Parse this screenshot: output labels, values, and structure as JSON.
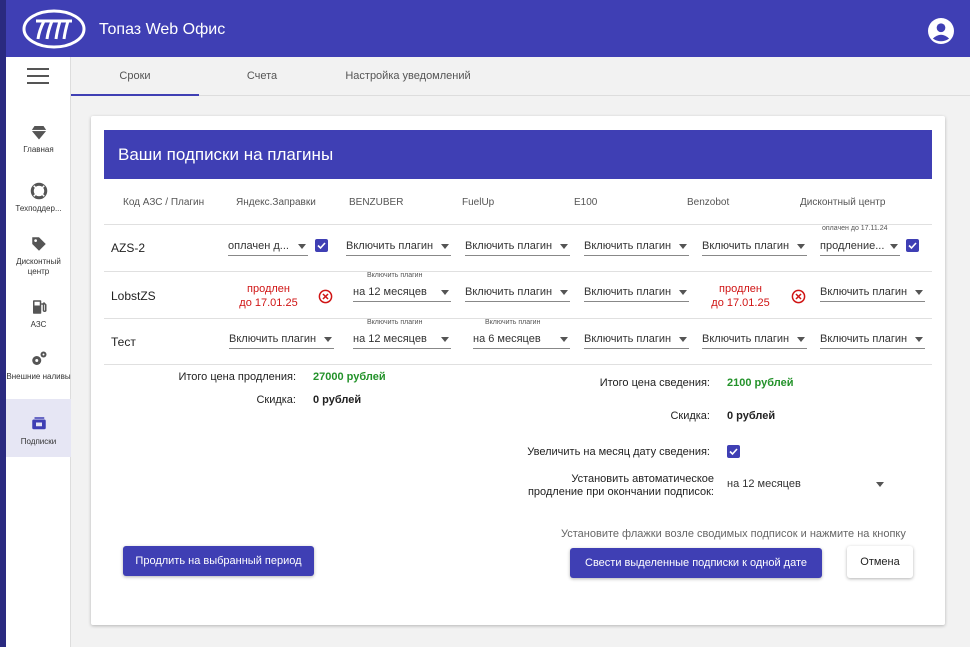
{
  "app": {
    "title": "Топаз Web Офис"
  },
  "sidebar": {
    "items": [
      {
        "label": "Главная",
        "icon": "diamond-icon"
      },
      {
        "label": "Техподдер...",
        "icon": "lifebuoy-icon"
      },
      {
        "label": "Дисконтный центр",
        "icon": "tag-icon"
      },
      {
        "label": "АЗС",
        "icon": "fuel-pump-icon"
      },
      {
        "label": "Внешние наливы",
        "icon": "gears-icon"
      },
      {
        "label": "Подписки",
        "icon": "subscriptions-icon"
      }
    ]
  },
  "tabs": [
    {
      "label": "Сроки",
      "active": true
    },
    {
      "label": "Счета",
      "active": false
    },
    {
      "label": "Настройка уведомлений",
      "active": false
    }
  ],
  "card": {
    "title": "Ваши подписки на плагины",
    "columns": [
      "Код АЗС / Плагин",
      "Яндекс.Заправки",
      "BENZUBER",
      "FuelUp",
      "E100",
      "Benzobot",
      "Дисконтный центр"
    ],
    "rows": [
      {
        "name": "AZS-2",
        "yandex": "оплачен д...",
        "benzuber": "Включить плагин",
        "fuelup": "Включить плагин",
        "e100": "Включить плагин",
        "benzobot": "Включить плагин",
        "discount": "продление...",
        "discount_note": "оплачен до 17.11.24"
      },
      {
        "name": "LobstZS",
        "yandex_line1": "продлен",
        "yandex_line2": "до 17.01.25",
        "benzuber_note": "Включить плагин",
        "benzuber": "на 12 месяцев",
        "fuelup": "Включить плагин",
        "e100": "Включить плагин",
        "benzobot_line1": "продлен",
        "benzobot_line2": "до 17.01.25",
        "discount": "Включить плагин"
      },
      {
        "name": "Тест",
        "yandex": "Включить плагин",
        "benzuber_note": "Включить плагин",
        "benzuber": "на 12 месяцев",
        "fuelup_note": "Включить плагин",
        "fuelup": "на 6 месяцев",
        "e100": "Включить плагин",
        "benzobot": "Включить плагин",
        "discount": "Включить плагин"
      }
    ],
    "summary": {
      "renewal_label": "Итого цена продления:",
      "renewal_value": "27000 рублей",
      "discount_label": "Скидка:",
      "discount_value": "0 рублей",
      "merge_label": "Итого цена сведения:",
      "merge_value": "2100 рублей",
      "merge_discount_label": "Скидка:",
      "merge_discount_value": "0 рублей",
      "extend_label": "Увеличить на месяц дату сведения:",
      "auto_label_line1": "Установить автоматическое",
      "auto_label_line2": "продление при окончании подписок:",
      "auto_value": "на 12 месяцев"
    },
    "hint": "Установите флажки возле сводимых подписок и нажмите на кнопку",
    "buttons": {
      "renew": "Продлить на выбранный период",
      "merge": "Свести выделенные подписки к одной дате",
      "cancel": "Отмена"
    }
  },
  "colors": {
    "primary": "#3f3fb4",
    "green": "#23922a",
    "red": "#d01515"
  }
}
